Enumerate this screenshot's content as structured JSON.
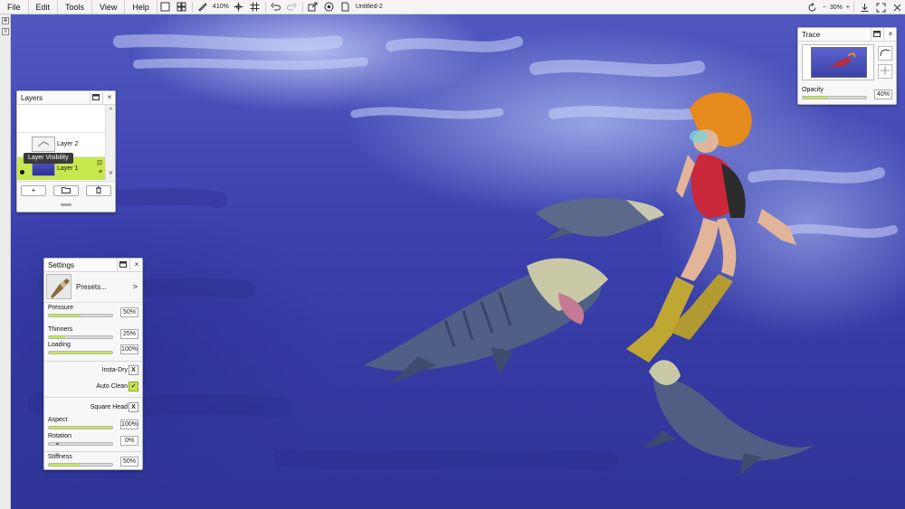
{
  "menu": {
    "items": [
      "File",
      "Edit",
      "Tools",
      "View",
      "Help"
    ]
  },
  "toolbar": {
    "zoom_label": "410%",
    "document_name": "Untitled-2",
    "right_zoom": "30%",
    "minus": "−",
    "plus": "+"
  },
  "layers": {
    "title": "Layers",
    "items": [
      {
        "name": "Layer 2"
      },
      {
        "name": "Layer 1"
      }
    ],
    "tooltip": "Layer Visibility",
    "add_label": "+",
    "scroll_up": "^",
    "scroll_down": "v"
  },
  "settings": {
    "title": "Settings",
    "presets_label": "Presets...",
    "presets_arrow": ">",
    "pressure": {
      "label": "Pressure",
      "value": "50%",
      "level": 0.5
    },
    "thinners": {
      "label": "Thinners",
      "value": "25%",
      "level": 0.25
    },
    "loading": {
      "label": "Loading",
      "value": "100%",
      "level": 1.0
    },
    "insta_dry": {
      "label": "Insta-Dry",
      "mark": "X"
    },
    "auto_clean": {
      "label": "Auto Clean",
      "mark": "✓"
    },
    "square_head": {
      "label": "Square Head",
      "mark": "X"
    },
    "aspect": {
      "label": "Aspect",
      "value": "100%",
      "level": 1.0
    },
    "rotation": {
      "label": "Rotation",
      "value": "0%",
      "level": 0.0
    },
    "stiffness": {
      "label": "Stiffness",
      "value": "50%",
      "level": 0.5
    }
  },
  "trace": {
    "title": "Trace",
    "opacity_label": "Opacity",
    "opacity_value": "40%",
    "opacity_level": 0.4
  },
  "colors": {
    "accent": "#c6e84d",
    "canvas_blue": "#3b40ad"
  }
}
